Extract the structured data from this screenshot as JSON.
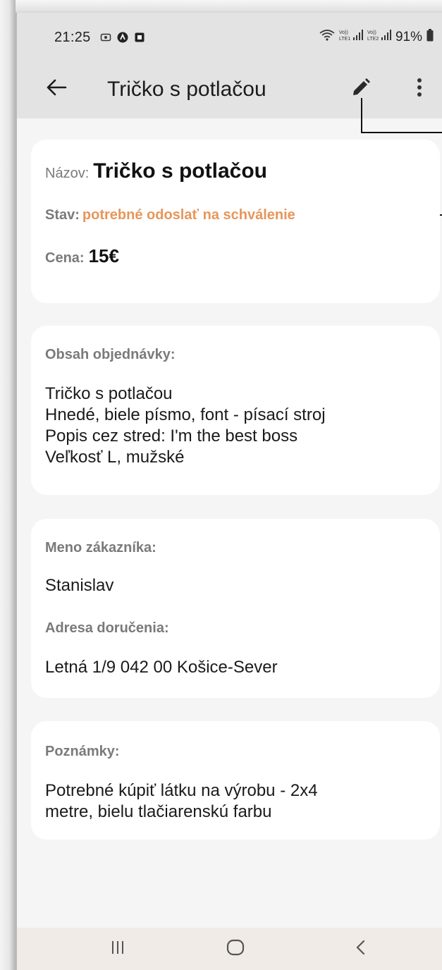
{
  "status_bar": {
    "time": "21:25",
    "battery": "91%",
    "left_icons": [
      "screen-record-icon",
      "app-notification-icon",
      "app-notification-icon-2"
    ],
    "right_icons": [
      "wifi-icon",
      "volte-lte1-signal-icon",
      "volte-lte2-signal-icon",
      "battery-icon"
    ]
  },
  "app_bar": {
    "title": "Tričko s potlačou",
    "back_icon": "arrow-left-icon",
    "edit_icon": "pencil-icon",
    "more_icon": "more-vertical-icon"
  },
  "summary": {
    "name_label": "Názov:",
    "name_value": "Tričko s potlačou",
    "status_label": "Stav:",
    "status_value": "potrebné odoslať na schválenie",
    "price_label": "Cena:",
    "price_value": "15€",
    "status_color": "#e7965a"
  },
  "order": {
    "label": "Obsah objednávky:",
    "lines": [
      "Tričko s potlačou",
      "Hnedé, biele písmo, font - písací stroj",
      "Popis cez stred: I'm the best boss",
      "Veľkosť L, mužské"
    ]
  },
  "customer": {
    "name_label": "Meno zákazníka:",
    "name_value": "Stanislav",
    "address_label": "Adresa doručenia:",
    "address_value": "Letná 1/9 042 00 Košice-Sever"
  },
  "notes": {
    "label": "Poznámky:",
    "lines": [
      "Potrebné kúpiť látku na výrobu - 2x4",
      "metre, bielu tlačiarenskú farbu"
    ]
  },
  "nav_bar": {
    "icons": [
      "recent-apps-icon",
      "home-icon",
      "back-chevron-icon"
    ]
  },
  "colors": {
    "app_bar": "#e3e3e3",
    "background": "#f5f5f5",
    "card": "#ffffff",
    "accent_status": "#e7965a"
  }
}
